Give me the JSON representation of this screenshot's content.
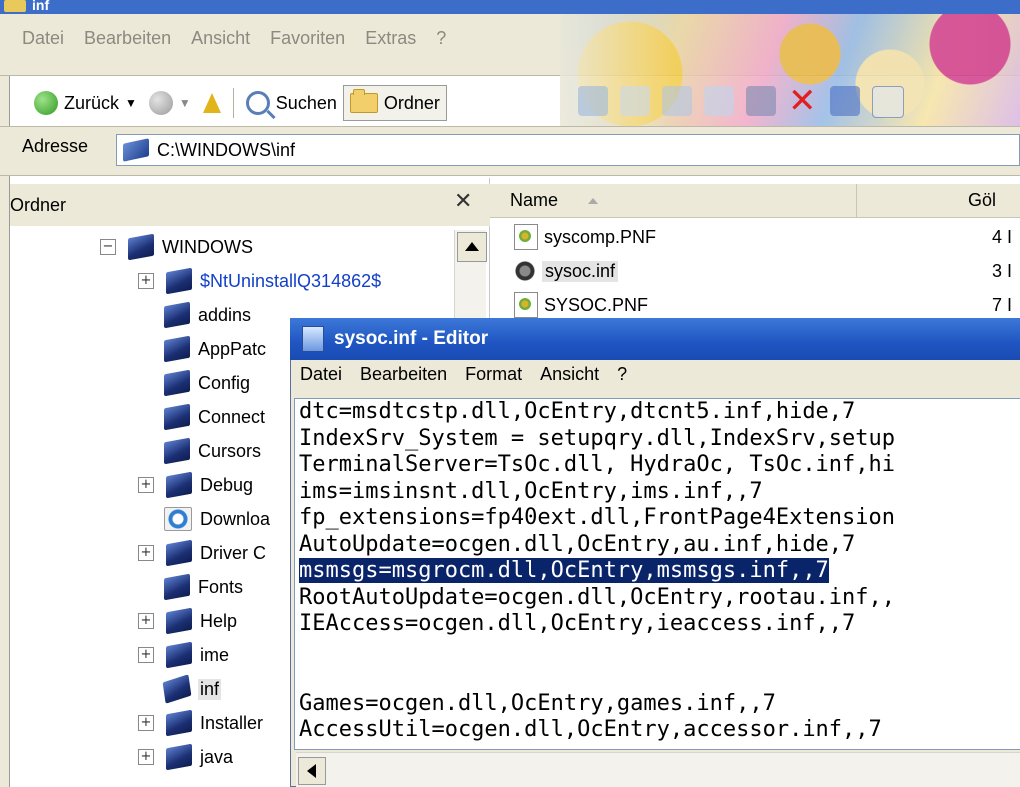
{
  "window": {
    "title": "inf"
  },
  "menu": [
    "Datei",
    "Bearbeiten",
    "Ansicht",
    "Favoriten",
    "Extras",
    "?"
  ],
  "toolbar": {
    "back": "Zurück",
    "search": "Suchen",
    "folders": "Ordner"
  },
  "address": {
    "label": "Adresse",
    "value": "C:\\WINDOWS\\inf"
  },
  "folder_panel": {
    "title": "Ordner",
    "items": [
      {
        "label": "WINDOWS",
        "expander": "−",
        "icon": "windows-folder-icon"
      },
      {
        "label": "$NtUninstallQ314862$",
        "expander": "+",
        "icon": "folder-icon"
      },
      {
        "label": "addins",
        "expander": "",
        "icon": "folder-icon"
      },
      {
        "label": "AppPatc",
        "expander": "",
        "icon": "folder-icon"
      },
      {
        "label": "Config",
        "expander": "",
        "icon": "folder-icon"
      },
      {
        "label": "Connect",
        "expander": "",
        "icon": "folder-icon"
      },
      {
        "label": "Cursors",
        "expander": "",
        "icon": "folder-icon"
      },
      {
        "label": "Debug",
        "expander": "+",
        "icon": "folder-icon"
      },
      {
        "label": "Downloa",
        "expander": "",
        "icon": "ie-folder-icon"
      },
      {
        "label": "Driver C",
        "expander": "+",
        "icon": "folder-icon"
      },
      {
        "label": "Fonts",
        "expander": "",
        "icon": "folder-icon"
      },
      {
        "label": "Help",
        "expander": "+",
        "icon": "folder-icon"
      },
      {
        "label": "ime",
        "expander": "+",
        "icon": "folder-icon"
      },
      {
        "label": "inf",
        "expander": "",
        "icon": "open-folder-icon",
        "selected": true
      },
      {
        "label": "Installer",
        "expander": "+",
        "icon": "folder-icon"
      },
      {
        "label": "java",
        "expander": "+",
        "icon": "folder-icon"
      }
    ]
  },
  "file_list": {
    "col_name": "Name",
    "col_size": "Göl",
    "rows": [
      {
        "name": "syscomp.PNF",
        "size": "4 I"
      },
      {
        "name": "sysoc.inf",
        "size": "3 I",
        "selected": true
      },
      {
        "name": "SYSOC.PNF",
        "size": "7 I"
      }
    ]
  },
  "editor": {
    "title": "sysoc.inf - Editor",
    "menu": [
      "Datei",
      "Bearbeiten",
      "Format",
      "Ansicht",
      "?"
    ],
    "lines": [
      "dtc=msdtcstp.dll,OcEntry,dtcnt5.inf,hide,7",
      "IndexSrv_System = setupqry.dll,IndexSrv,setup",
      "TerminalServer=TsOc.dll, HydraOc, TsOc.inf,hi",
      "ims=imsinsnt.dll,OcEntry,ims.inf,,7",
      "fp_extensions=fp40ext.dll,FrontPage4Extension",
      "AutoUpdate=ocgen.dll,OcEntry,au.inf,hide,7",
      "msmsgs=msgrocm.dll,OcEntry,msmsgs.inf,,7",
      "RootAutoUpdate=ocgen.dll,OcEntry,rootau.inf,,",
      "IEAccess=ocgen.dll,OcEntry,ieaccess.inf,,7",
      "",
      "",
      "Games=ocgen.dll,OcEntry,games.inf,,7",
      "AccessUtil=ocgen.dll,OcEntry,accessor.inf,,7"
    ],
    "highlighted_line": 6
  }
}
